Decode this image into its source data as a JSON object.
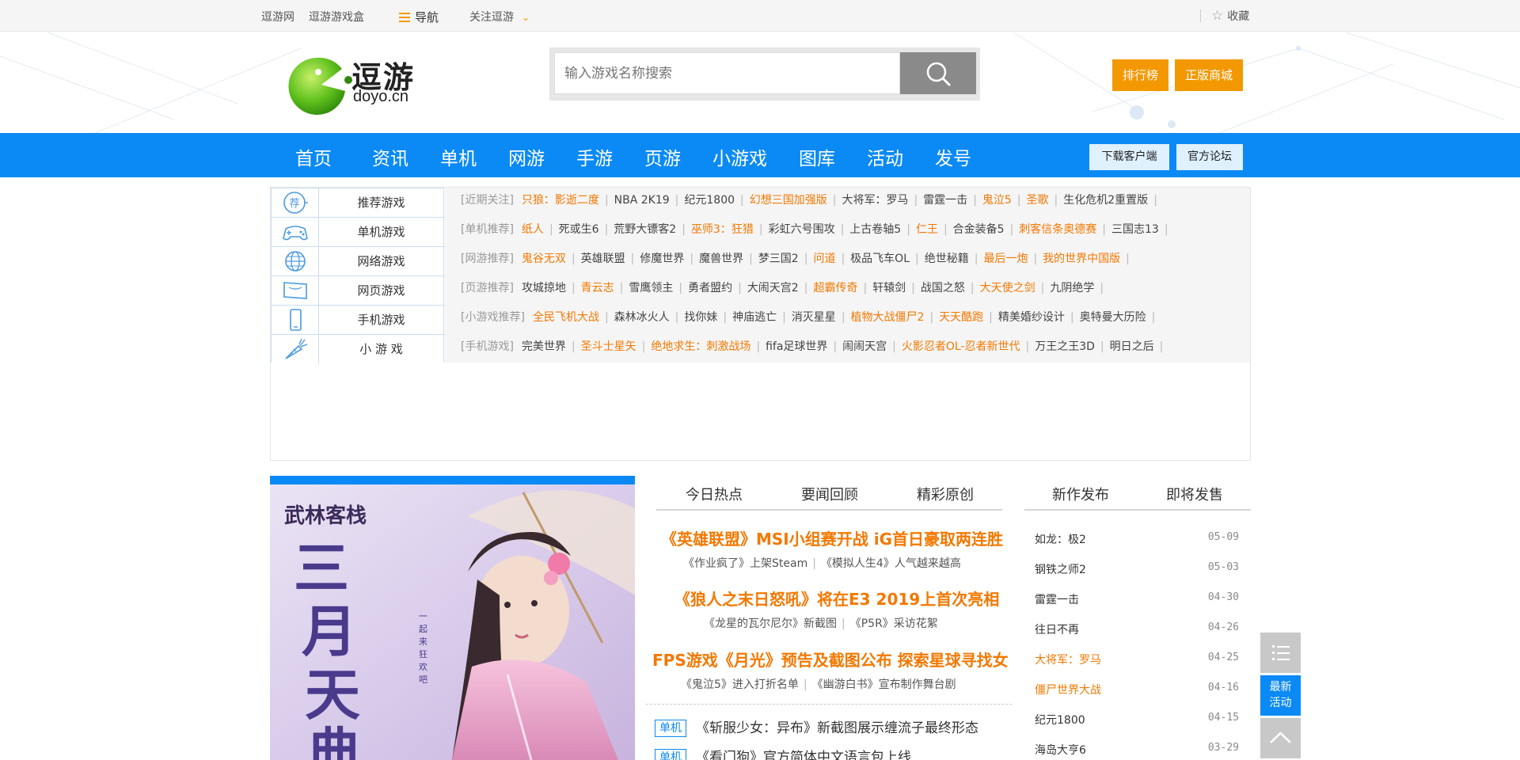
{
  "topbar": {
    "site_name": "逗游网",
    "gamebox": "逗游游戏盒",
    "nav_label": "导航",
    "follow_label": "关注逗游",
    "favorite_label": "收藏"
  },
  "header": {
    "logo_cn": "逗游",
    "logo_en": "doyo.cn",
    "search_placeholder": "输入游戏名称搜索",
    "ranking_button": "排行榜",
    "store_button": "正版商城"
  },
  "nav": {
    "items": [
      "首页",
      "资讯",
      "单机",
      "网游",
      "手游",
      "页游",
      "小游戏",
      "图库",
      "活动",
      "发号"
    ],
    "download_client": "下载客户端",
    "official_forum": "官方论坛"
  },
  "categories": [
    {
      "label": "推荐游戏",
      "icon": "recommend-icon"
    },
    {
      "label": "单机游戏",
      "icon": "gamepad-icon"
    },
    {
      "label": "网络游戏",
      "icon": "globe-icon"
    },
    {
      "label": "网页游戏",
      "icon": "webpage-icon"
    },
    {
      "label": "手机游戏",
      "icon": "phone-icon"
    },
    {
      "label": "小 游 戏",
      "icon": "carrot-icon"
    }
  ],
  "rows": [
    {
      "tag": "[近期关注]",
      "items": [
        [
          "只狼：影逝二度",
          "o"
        ],
        [
          "NBA 2K19",
          "g"
        ],
        [
          "纪元1800",
          "g"
        ],
        [
          "幻想三国加强版",
          "o"
        ],
        [
          "大将军：罗马",
          "g"
        ],
        [
          "雷霆一击",
          "g"
        ],
        [
          "鬼泣5",
          "o"
        ],
        [
          "圣歌",
          "o"
        ],
        [
          "生化危机2重置版",
          "g"
        ]
      ]
    },
    {
      "tag": "[单机推荐]",
      "items": [
        [
          "纸人",
          "o"
        ],
        [
          "死或生6",
          "g"
        ],
        [
          "荒野大镖客2",
          "g"
        ],
        [
          "巫师3：狂猎",
          "o"
        ],
        [
          "彩虹六号围攻",
          "g"
        ],
        [
          "上古卷轴5",
          "g"
        ],
        [
          "仁王",
          "o"
        ],
        [
          "合金装备5",
          "g"
        ],
        [
          "刺客信条奥德赛",
          "o"
        ],
        [
          "三国志13",
          "g"
        ]
      ]
    },
    {
      "tag": "[网游推荐]",
      "items": [
        [
          "鬼谷无双",
          "o"
        ],
        [
          "英雄联盟",
          "g"
        ],
        [
          "修魔世界",
          "g"
        ],
        [
          "魔兽世界",
          "g"
        ],
        [
          "梦三国2",
          "g"
        ],
        [
          "问道",
          "o"
        ],
        [
          "极品飞车OL",
          "g"
        ],
        [
          "绝世秘籍",
          "g"
        ],
        [
          "最后一炮",
          "o"
        ],
        [
          "我的世界中国版",
          "o"
        ]
      ]
    },
    {
      "tag": "[页游推荐]",
      "items": [
        [
          "攻城掠地",
          "g"
        ],
        [
          "青云志",
          "o"
        ],
        [
          "雪鹰领主",
          "g"
        ],
        [
          "勇者盟约",
          "g"
        ],
        [
          "大闹天宫2",
          "g"
        ],
        [
          "超霸传奇",
          "o"
        ],
        [
          "轩辕剑",
          "g"
        ],
        [
          "战国之怒",
          "g"
        ],
        [
          "大天使之剑",
          "o"
        ],
        [
          "九阴绝学",
          "g"
        ]
      ]
    },
    {
      "tag": "[小游戏推荐]",
      "items": [
        [
          "全民飞机大战",
          "o"
        ],
        [
          "森林冰火人",
          "g"
        ],
        [
          "找你妹",
          "g"
        ],
        [
          "神庙逃亡",
          "g"
        ],
        [
          "消灭星星",
          "g"
        ],
        [
          "植物大战僵尸2",
          "o"
        ],
        [
          "天天酷跑",
          "o"
        ],
        [
          "精美婚纱设计",
          "g"
        ],
        [
          "奥特曼大历险",
          "g"
        ]
      ]
    },
    {
      "tag": "[手机游戏]",
      "items": [
        [
          "完美世界",
          "g"
        ],
        [
          "圣斗士星矢",
          "o"
        ],
        [
          "绝地求生：刺激战场",
          "o"
        ],
        [
          "fifa足球世界",
          "g"
        ],
        [
          "闹闹天宫",
          "g"
        ],
        [
          "火影忍者OL-忍者新世代",
          "o"
        ],
        [
          "万王之王3D",
          "g"
        ],
        [
          "明日之后",
          "g"
        ]
      ]
    }
  ],
  "banner": {
    "game_logo": "武林客栈",
    "art_text": "三月天典",
    "side_text": "一起来狂欢吧"
  },
  "news": {
    "tabs": [
      "今日热点",
      "要闻回顾",
      "精彩原创"
    ],
    "headlines": [
      {
        "title": "《英雄联盟》MSI小组赛开战 iG首日豪取两连胜",
        "subs": [
          "《作业疯了》上架Steam",
          "《模拟人生4》人气越来越高"
        ]
      },
      {
        "title": "《狼人之末日怒吼》将在E3 2019上首次亮相",
        "subs": [
          "《龙星的瓦尔尼尔》新截图",
          "《P5R》采访花絮"
        ]
      },
      {
        "title": "FPS游戏《月光》预告及截图公布 探索星球寻找女",
        "subs": [
          "《鬼泣5》进入打折名单",
          "《幽游白书》宣布制作舞台剧"
        ]
      }
    ],
    "list": [
      {
        "badge": "单机",
        "text": "《斩服少女：异布》新截图展示缠流子最终形态"
      },
      {
        "badge": "单机",
        "text": "《看门狗》官方简体中文语言包上线"
      }
    ]
  },
  "releases": {
    "tabs": [
      "新作发布",
      "即将发售"
    ],
    "items": [
      {
        "name": "如龙：极2",
        "date": "05-09",
        "hot": false
      },
      {
        "name": "钢铁之师2",
        "date": "05-03",
        "hot": false
      },
      {
        "name": "雷霆一击",
        "date": "04-30",
        "hot": false
      },
      {
        "name": "往日不再",
        "date": "04-26",
        "hot": false
      },
      {
        "name": "大将军：罗马",
        "date": "04-25",
        "hot": true
      },
      {
        "name": "僵尸世界大战",
        "date": "04-16",
        "hot": true
      },
      {
        "name": "纪元1800",
        "date": "04-15",
        "hot": false
      },
      {
        "name": "海岛大亨6",
        "date": "03-29",
        "hot": false
      }
    ]
  },
  "floating": {
    "activity_line1": "最新",
    "activity_line2": "活动"
  },
  "colors": {
    "brand_blue": "#0b8af5",
    "accent_orange": "#f39800",
    "highlight_text": "#f37800"
  }
}
